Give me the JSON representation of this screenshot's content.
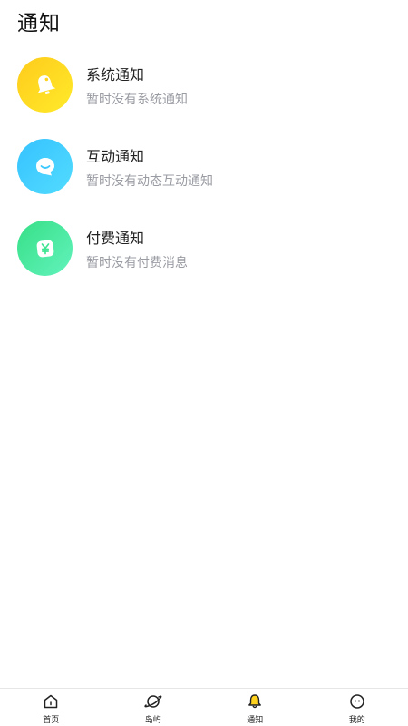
{
  "header": {
    "title": "通知"
  },
  "notifications": [
    {
      "title": "系统通知",
      "subtitle": "暂时没有系统通知",
      "icon": "bell-icon",
      "colors": [
        "#ffcf1f",
        "#ffe81f"
      ]
    },
    {
      "title": "互动通知",
      "subtitle": "暂时没有动态互动通知",
      "icon": "chat-bubble-icon",
      "colors": [
        "#3cc6ff",
        "#4fd9ff"
      ]
    },
    {
      "title": "付费通知",
      "subtitle": "暂时没有付费消息",
      "icon": "yen-icon",
      "colors": [
        "#3de38c",
        "#5ef2b6"
      ]
    }
  ],
  "tabbar": {
    "tabs": [
      {
        "label": "首页",
        "icon": "home-icon"
      },
      {
        "label": "岛屿",
        "icon": "planet-icon"
      },
      {
        "label": "通知",
        "icon": "bell-icon",
        "active": true
      },
      {
        "label": "我的",
        "icon": "face-icon"
      }
    ]
  }
}
